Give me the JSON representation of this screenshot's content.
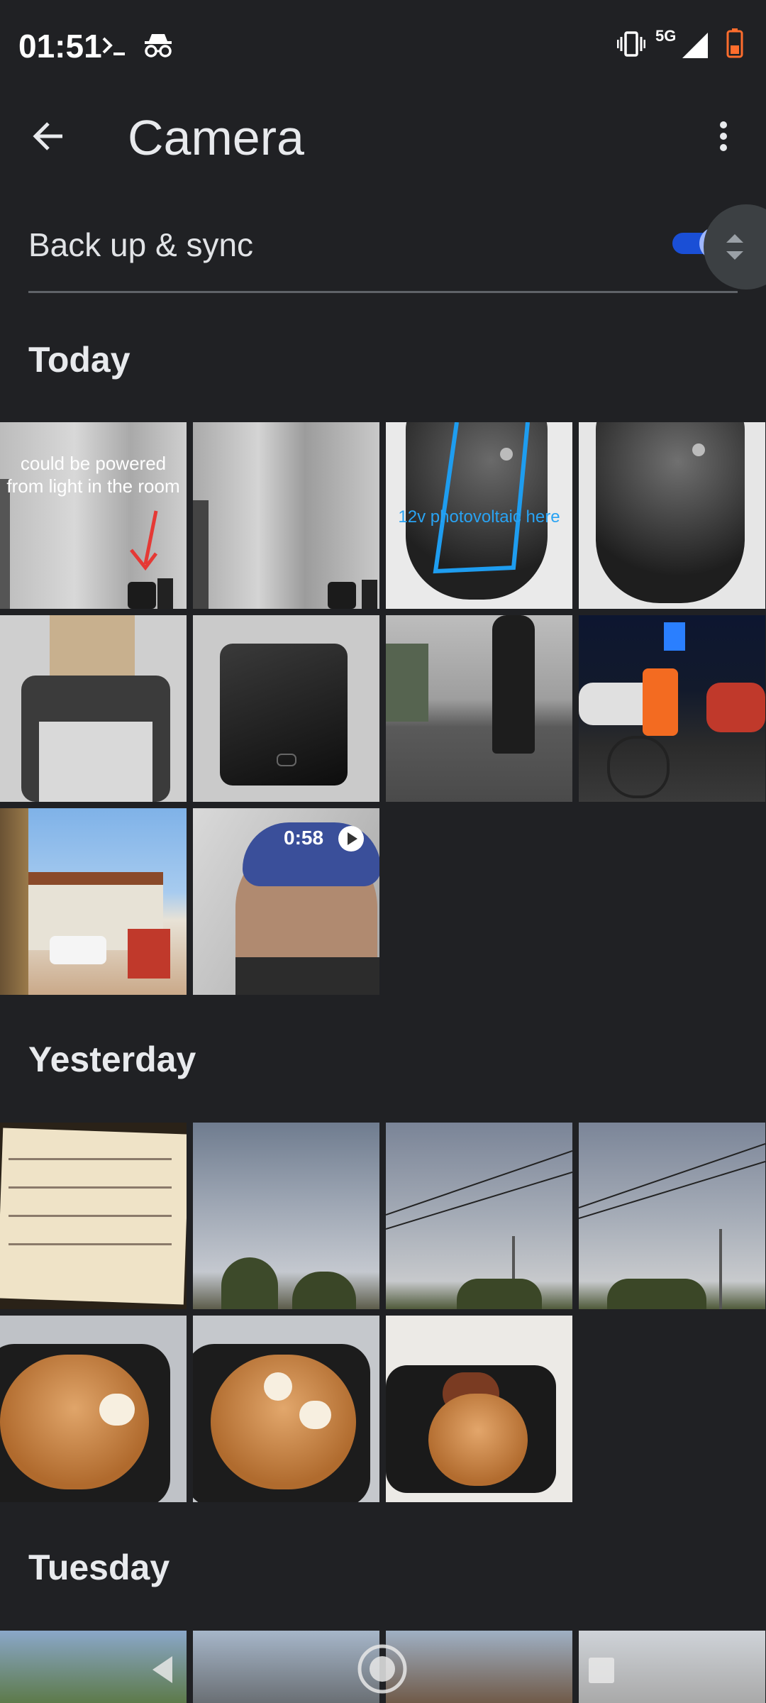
{
  "status_bar": {
    "time": "01:51",
    "network": "5G",
    "icons_left": [
      "terminal-icon",
      "incognito-icon"
    ],
    "icons_right": [
      "vibrate-icon",
      "signal-icon",
      "battery-icon"
    ]
  },
  "app_bar": {
    "title": "Camera",
    "back_icon": "arrow-back-icon",
    "more_icon": "more-vert-icon"
  },
  "backup": {
    "label": "Back up & sync",
    "enabled": true,
    "accent": "#1a4fd6"
  },
  "sections": [
    {
      "title": "Today",
      "photos": [
        {
          "caption": "could be powered from light in the room"
        },
        {
          "caption": ""
        },
        {
          "caption": "12v photovoltaic here"
        },
        {
          "caption": ""
        },
        {
          "caption": ""
        },
        {
          "caption": ""
        },
        {
          "caption": ""
        },
        {
          "caption": ""
        },
        {
          "caption": ""
        },
        {
          "caption": "",
          "video_duration": "0:58"
        }
      ]
    },
    {
      "title": "Yesterday",
      "photos": [
        {
          "caption": ""
        },
        {
          "caption": ""
        },
        {
          "caption": ""
        },
        {
          "caption": ""
        },
        {
          "caption": ""
        },
        {
          "caption": ""
        },
        {
          "caption": ""
        }
      ]
    },
    {
      "title": "Tuesday",
      "photos": [
        {
          "caption": ""
        },
        {
          "caption": ""
        },
        {
          "caption": ""
        },
        {
          "caption": ""
        }
      ]
    }
  ],
  "nav_bar": {
    "back": "nav-back-icon",
    "home": "nav-home-icon",
    "recents": "nav-recents-icon"
  }
}
